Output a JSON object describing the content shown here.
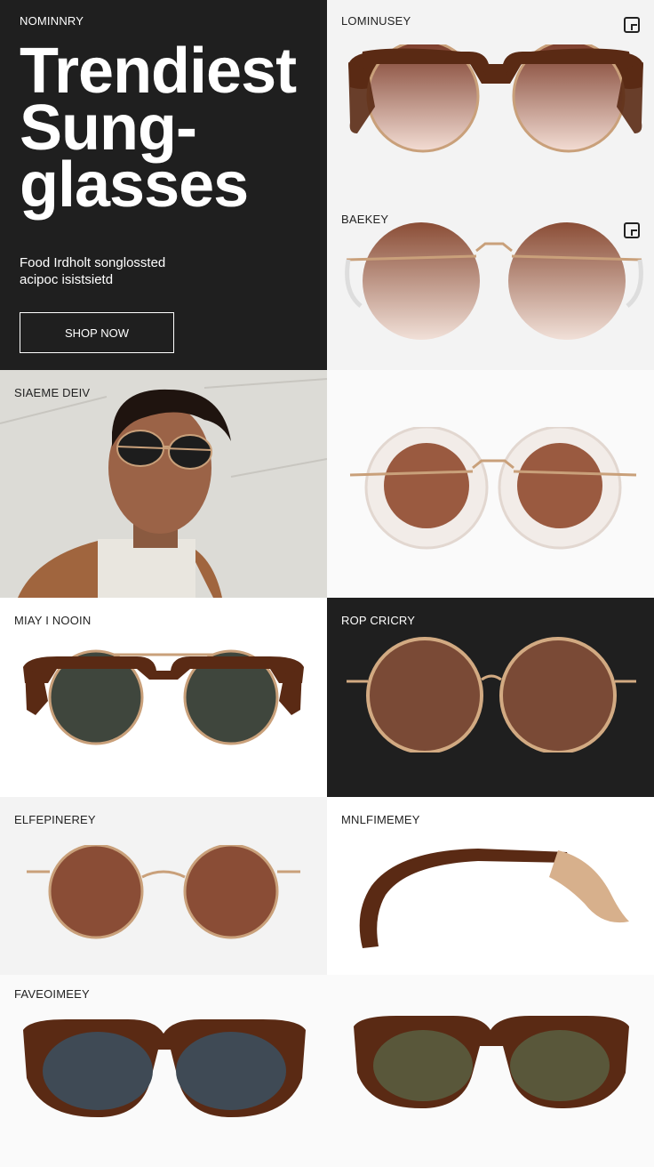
{
  "hero": {
    "label": "NOMINNRY",
    "title": "Trendiest Sung-glasses",
    "subtitle_line1": "Food Irdholt songlossted",
    "subtitle_line2": "acipoc isistsietd",
    "cta": "SHOP NOW"
  },
  "products": [
    {
      "label": "LOMINUSEY"
    },
    {
      "label": "BAEKEY"
    },
    {
      "label": "SIAEME DEIV"
    },
    {
      "label": ""
    },
    {
      "label": "MIAY I NOOIN"
    },
    {
      "label": "ROP CRICRY"
    },
    {
      "label": "ELFEPINEREY"
    },
    {
      "label": "MNLFIMEMEY"
    },
    {
      "label": "FAVEOIMEEY"
    },
    {
      "label": ""
    }
  ],
  "colors": {
    "dark_bg": "#1f1f1f",
    "tortoise": "#5a2a14",
    "gold": "#c9a07a",
    "brown_lens": "#8a4d36",
    "green_lens": "#3f463d"
  }
}
